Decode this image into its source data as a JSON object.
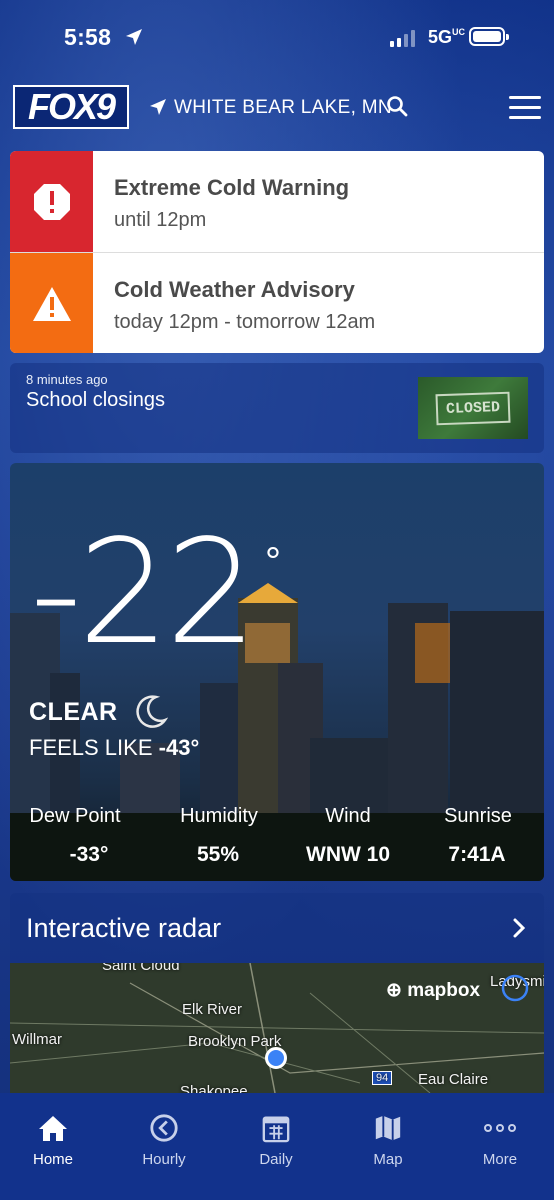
{
  "status_bar": {
    "time": "5:58",
    "network": "5G",
    "network_sub": "UC"
  },
  "header": {
    "logo": "FOX9",
    "location": "WHITE BEAR LAKE, MN"
  },
  "alerts": [
    {
      "title": "Extreme Cold Warning",
      "subtitle": "until 12pm",
      "color": "#d8262f"
    },
    {
      "title": "Cold Weather Advisory",
      "subtitle": "today 12pm - tomorrow 12am",
      "color": "#f36c12"
    }
  ],
  "school": {
    "time_ago": "8 minutes ago",
    "headline": "School closings",
    "thumb_text": "CLOSED"
  },
  "weather": {
    "temperature": "-22",
    "degree": "°",
    "condition": "CLEAR",
    "feels_like_label": "FEELS LIKE",
    "feels_like_value": "-43°",
    "stats": [
      {
        "label": "Dew Point",
        "value": "-33°"
      },
      {
        "label": "Humidity",
        "value": "55%"
      },
      {
        "label": "Wind",
        "value": "WNW 10"
      },
      {
        "label": "Sunrise",
        "value": "7:41A"
      }
    ]
  },
  "radar": {
    "title": "Interactive radar",
    "attribution": "mapbox",
    "places": [
      "Saint Cloud",
      "Elk River",
      "Willmar",
      "Brooklyn Park",
      "Shakopee",
      "Eau Claire",
      "Ladysmith"
    ],
    "highway": "94"
  },
  "nav": [
    {
      "label": "Home",
      "icon": "home-icon",
      "active": true
    },
    {
      "label": "Hourly",
      "icon": "clock-icon",
      "active": false
    },
    {
      "label": "Daily",
      "icon": "calendar-icon",
      "active": false
    },
    {
      "label": "Map",
      "icon": "map-icon",
      "active": false
    },
    {
      "label": "More",
      "icon": "more-icon",
      "active": false
    }
  ]
}
